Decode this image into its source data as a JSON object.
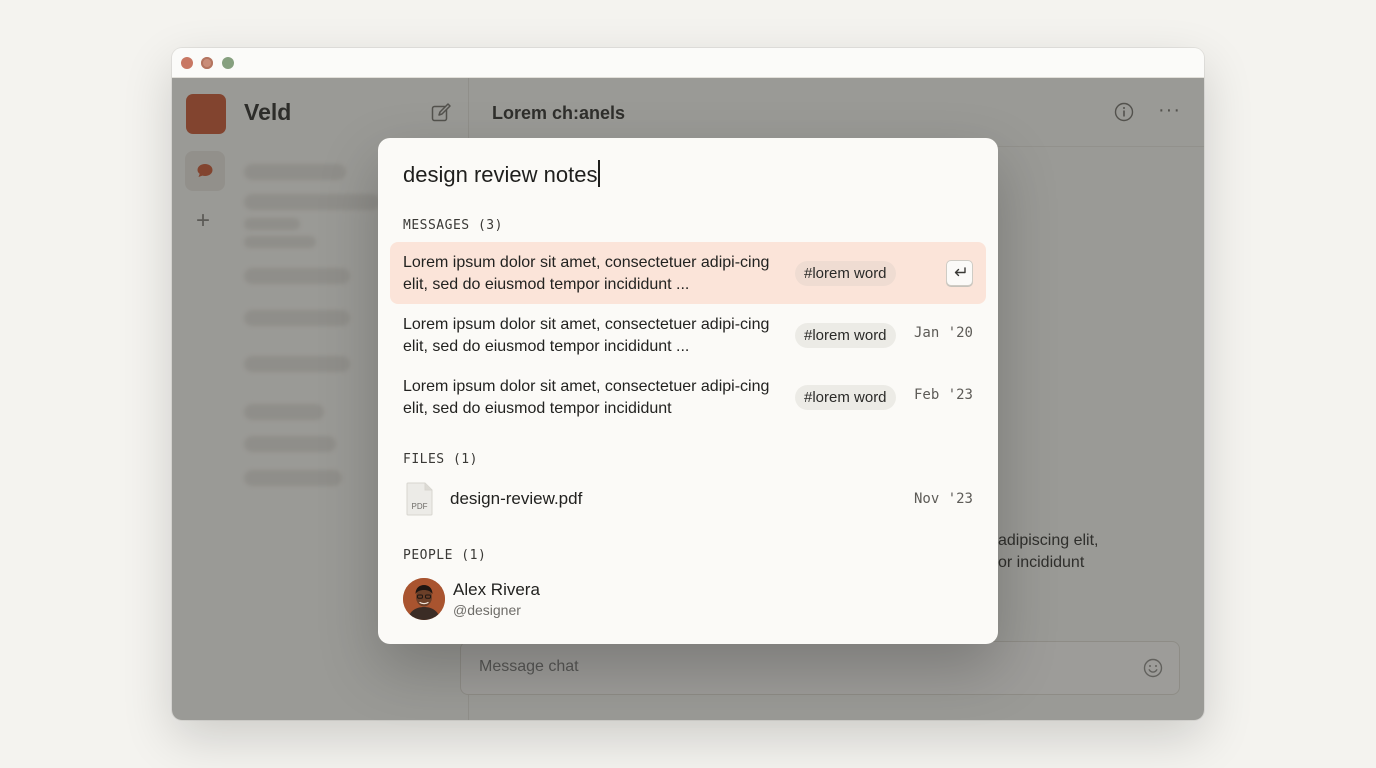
{
  "app": {
    "brand": "Veld",
    "channel_title": "Lorem ch:anels",
    "background_message": [
      "adipiscing elit,",
      "or incididunt"
    ],
    "composer_placeholder": "Message chat"
  },
  "search": {
    "query": "design review notes",
    "messages_header": "MESSAGES (3)",
    "messages": [
      {
        "text": "Lorem ipsum dolor sit amet, consectetuer adipi-cing elit, sed do eiusmod tempor incididunt ...",
        "tag": "#lorem word",
        "date": "",
        "selected": true
      },
      {
        "text": "Lorem ipsum dolor sit amet, consectetuer adipi-cing elit, sed do eiusmod tempor incididunt ...",
        "tag": "#lorem word",
        "date": "Jan '20",
        "selected": false
      },
      {
        "text": "Lorem ipsum dolor sit amet, consectetuer adipi-cing elit, sed do eiusmod tempor incididunt",
        "tag": "#lorem word",
        "date": "Feb '23",
        "selected": false
      }
    ],
    "files_header": "FILES (1)",
    "files": [
      {
        "name": "design-review.pdf",
        "date": "Nov '23",
        "icon_label": "PDF"
      }
    ],
    "people_header": "PEOPLE (1)",
    "people": [
      {
        "name": "Alex Rivera",
        "handle": "@designer"
      }
    ]
  },
  "icons": [
    "chat-bubble-icon",
    "plus-icon",
    "compose-icon",
    "info-icon",
    "more-icon",
    "emoji-icon",
    "enter-key-icon",
    "pdf-file-icon"
  ],
  "colors": {
    "brand": "#c8522d",
    "selected_row": "#fbe4d9"
  }
}
